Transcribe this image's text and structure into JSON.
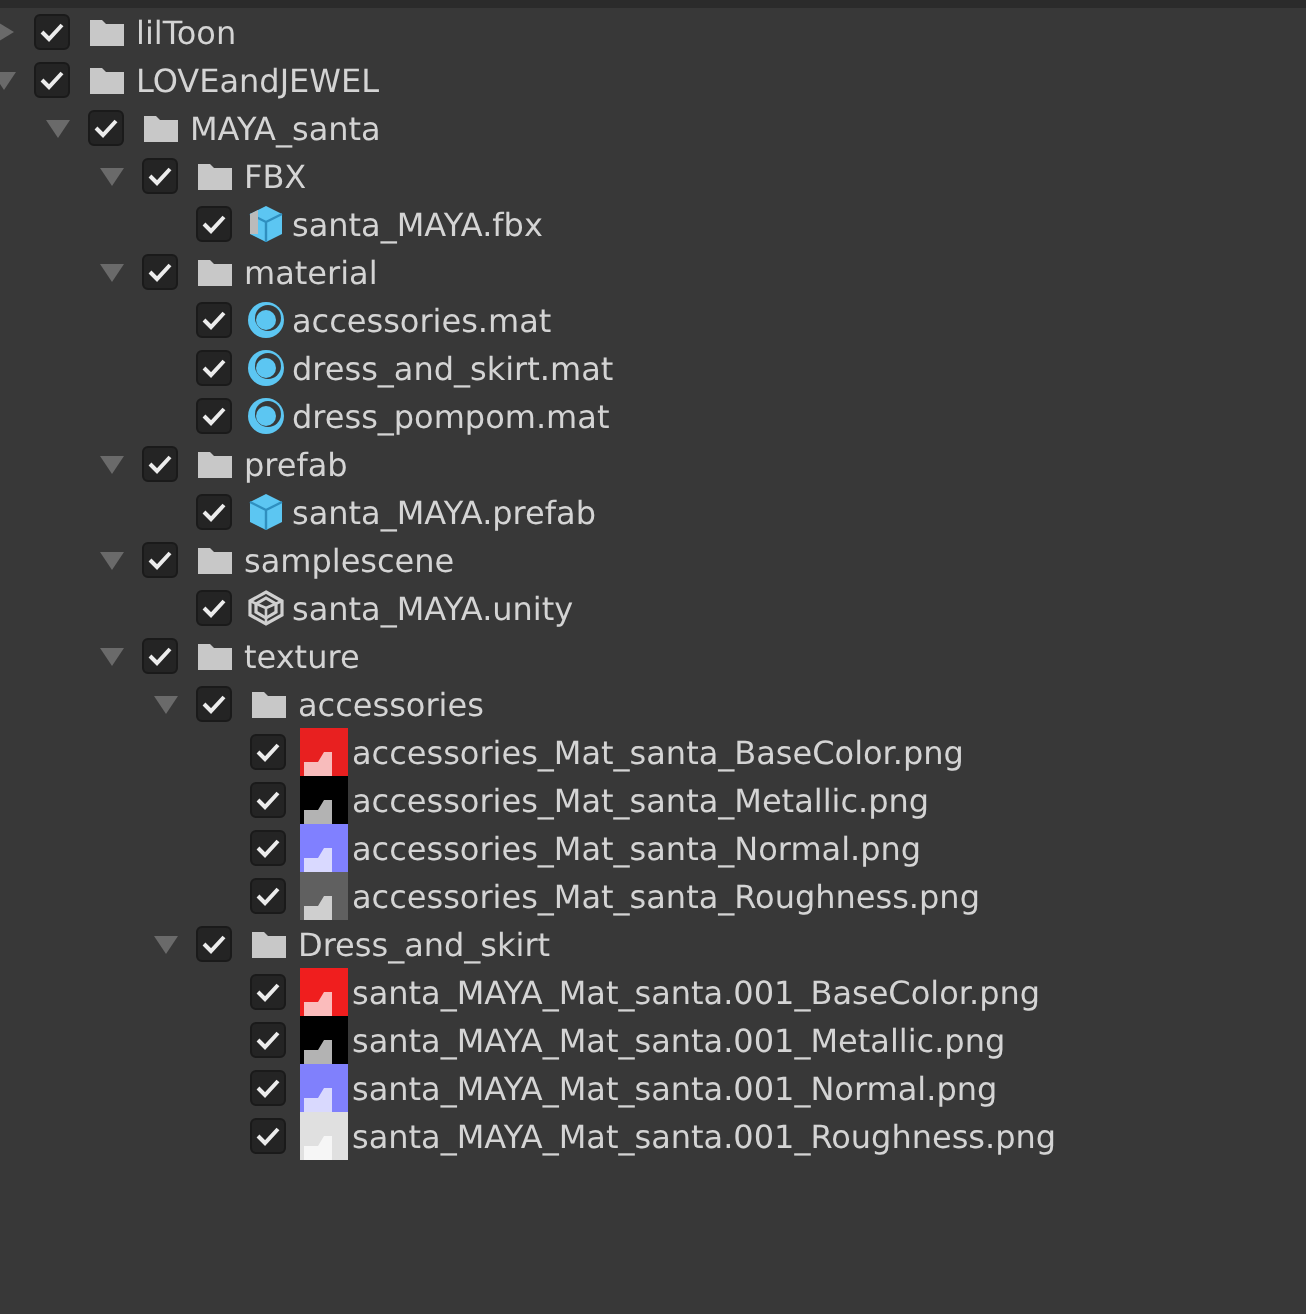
{
  "tree": [
    {
      "kind": "folder",
      "label": "lilToon",
      "checked": true,
      "expanded": false
    },
    {
      "kind": "folder",
      "label": "LOVEandJEWEL",
      "checked": true,
      "expanded": true,
      "children": [
        {
          "kind": "folder",
          "label": "MAYA_santa",
          "checked": true,
          "expanded": true,
          "children": [
            {
              "kind": "folder",
              "label": "FBX",
              "checked": true,
              "expanded": true,
              "children": [
                {
                  "kind": "mesh",
                  "label": "santa_MAYA.fbx",
                  "checked": true
                }
              ]
            },
            {
              "kind": "folder",
              "label": "material",
              "checked": true,
              "expanded": true,
              "children": [
                {
                  "kind": "material",
                  "label": "accessories.mat",
                  "checked": true
                },
                {
                  "kind": "material",
                  "label": "dress_and_skirt.mat",
                  "checked": true
                },
                {
                  "kind": "material",
                  "label": "dress_pompom.mat",
                  "checked": true
                }
              ]
            },
            {
              "kind": "folder",
              "label": "prefab",
              "checked": true,
              "expanded": true,
              "children": [
                {
                  "kind": "prefab",
                  "label": "santa_MAYA.prefab",
                  "checked": true
                }
              ]
            },
            {
              "kind": "folder",
              "label": "samplescene",
              "checked": true,
              "expanded": true,
              "children": [
                {
                  "kind": "scene",
                  "label": "santa_MAYA.unity",
                  "checked": true
                }
              ]
            },
            {
              "kind": "folder",
              "label": "texture",
              "checked": true,
              "expanded": true,
              "children": [
                {
                  "kind": "folder",
                  "label": "accessories",
                  "checked": true,
                  "expanded": true,
                  "children": [
                    {
                      "kind": "texture",
                      "label": "accessories_Mat_santa_BaseColor.png",
                      "checked": true,
                      "color": "#e82020"
                    },
                    {
                      "kind": "texture",
                      "label": "accessories_Mat_santa_Metallic.png",
                      "checked": true,
                      "color": "#000000"
                    },
                    {
                      "kind": "texture",
                      "label": "accessories_Mat_santa_Normal.png",
                      "checked": true,
                      "color": "#8080ff"
                    },
                    {
                      "kind": "texture",
                      "label": "accessories_Mat_santa_Roughness.png",
                      "checked": true,
                      "color": "#606060"
                    }
                  ]
                },
                {
                  "kind": "folder",
                  "label": "Dress_and_skirt",
                  "checked": true,
                  "expanded": true,
                  "children": [
                    {
                      "kind": "texture",
                      "label": "santa_MAYA_Mat_santa.001_BaseColor.png",
                      "checked": true,
                      "color": "#f01e1e"
                    },
                    {
                      "kind": "texture",
                      "label": "santa_MAYA_Mat_santa.001_Metallic.png",
                      "checked": true,
                      "color": "#000000"
                    },
                    {
                      "kind": "texture",
                      "label": "santa_MAYA_Mat_santa.001_Normal.png",
                      "checked": true,
                      "color": "#8080fc"
                    },
                    {
                      "kind": "texture",
                      "label": "santa_MAYA_Mat_santa.001_Roughness.png",
                      "checked": true,
                      "color": "#e0e0e0"
                    }
                  ]
                }
              ]
            }
          ]
        }
      ]
    }
  ]
}
